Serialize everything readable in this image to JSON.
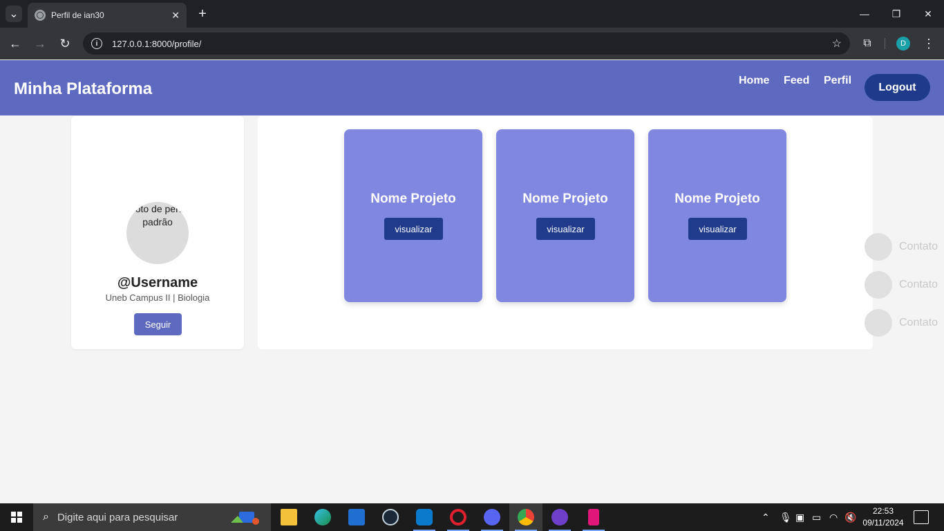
{
  "browser": {
    "tab_title": "Perfil de ian30",
    "tab_close": "✕",
    "new_tab": "+",
    "url": "127.0.0.1:8000/profile/",
    "profile_initial": "D",
    "window_controls": {
      "minimize": "—",
      "restore": "❐",
      "close": "✕"
    }
  },
  "site": {
    "brand": "Minha Plataforma",
    "nav": [
      {
        "label": "Home"
      },
      {
        "label": "Feed"
      },
      {
        "label": "Perfil"
      }
    ],
    "logout_label": "Logout"
  },
  "profile": {
    "avatar_alt": "Foto de perfil padrão",
    "username": "@Username",
    "campus": "Uneb Campus II | Biologia",
    "follow_label": "Seguir"
  },
  "projects": [
    {
      "name": "Nome Projeto",
      "button": "visualizar"
    },
    {
      "name": "Nome Projeto",
      "button": "visualizar"
    },
    {
      "name": "Nome Projeto",
      "button": "visualizar"
    }
  ],
  "contacts": [
    {
      "label": "Contato"
    },
    {
      "label": "Contato"
    },
    {
      "label": "Contato"
    }
  ],
  "taskbar": {
    "search_placeholder": "Digite aqui para pesquisar",
    "time": "22:53",
    "date": "09/11/2024",
    "apps": [
      "file-explorer",
      "edge",
      "store",
      "steam",
      "vscode",
      "opera",
      "discord",
      "chrome",
      "github",
      "app"
    ]
  },
  "colors": {
    "header": "#5e6ac0",
    "logout": "#1f3a8a",
    "project_card": "#7f87e0",
    "project_button": "#203a8c"
  }
}
